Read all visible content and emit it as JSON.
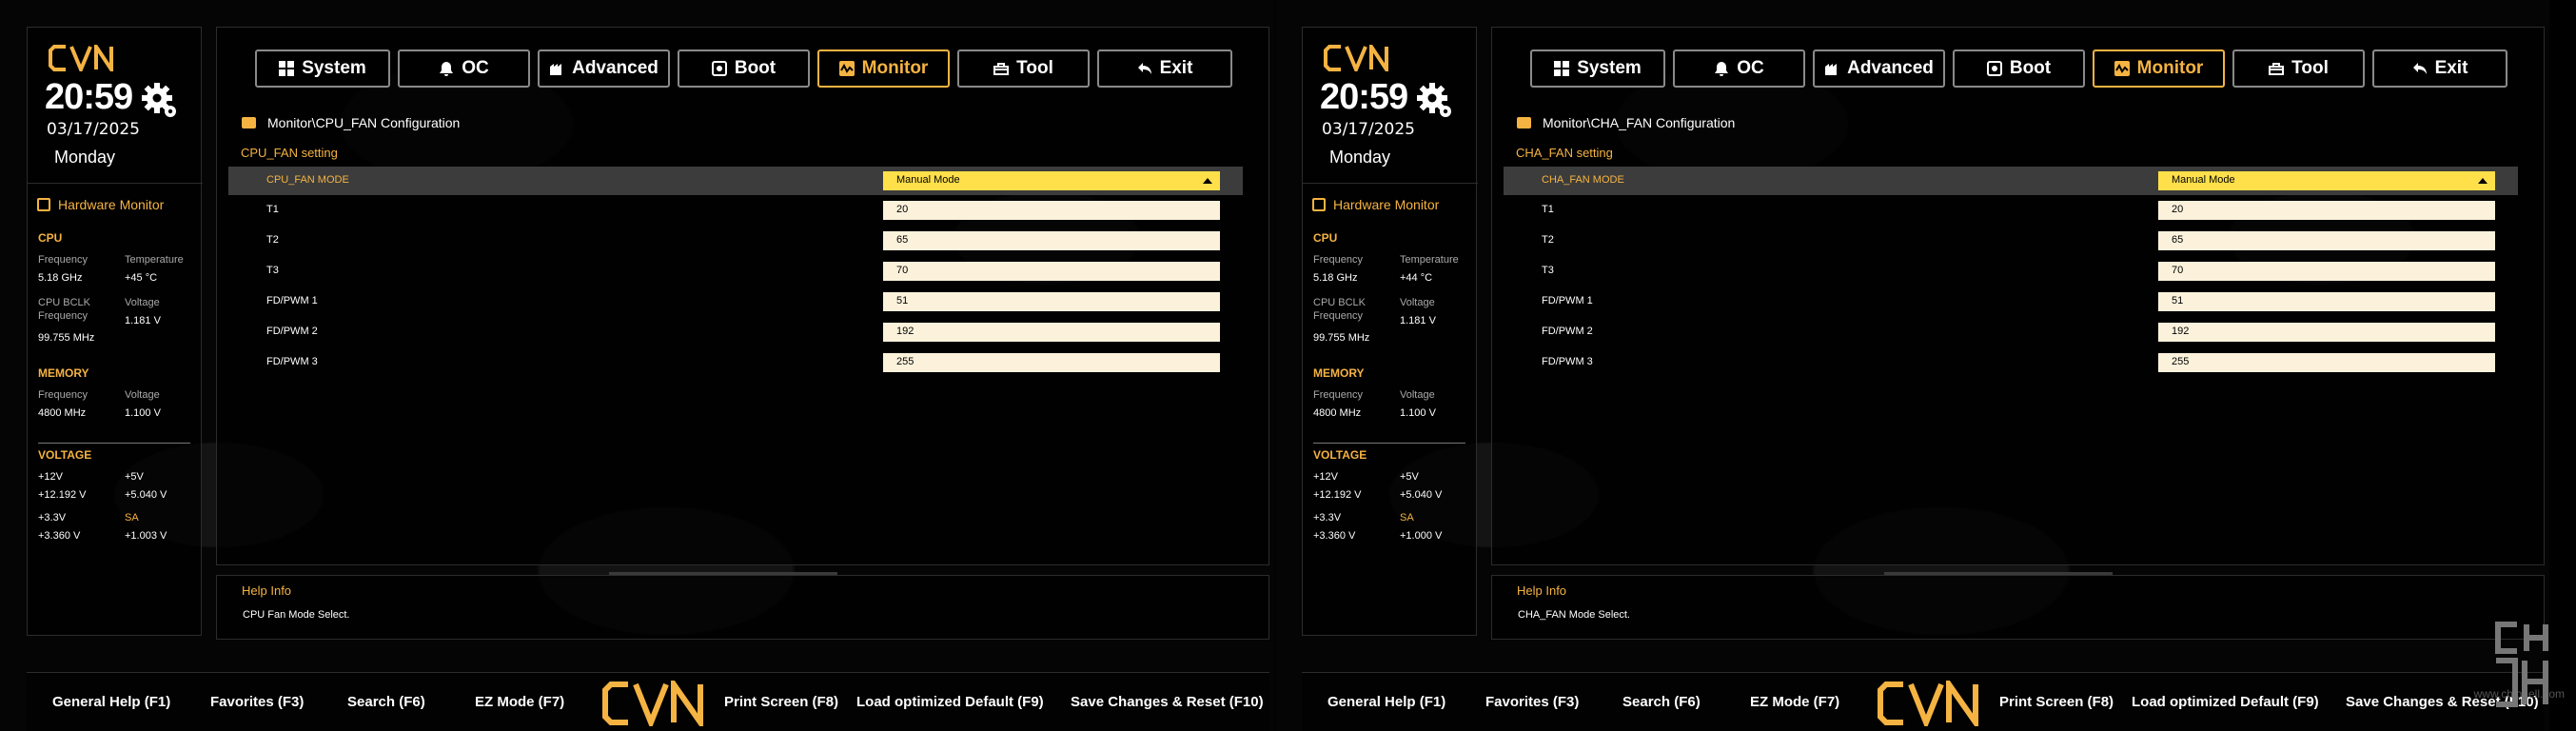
{
  "brand": {
    "accent": "#f5b342",
    "field_bg": "#fcf2dc",
    "dropdown_bg": "#ffe04a",
    "logo_text": "CVN"
  },
  "tabs": [
    {
      "label": "System",
      "icon": "grid-icon"
    },
    {
      "label": "OC",
      "icon": "bell-icon"
    },
    {
      "label": "Advanced",
      "icon": "chip-icon"
    },
    {
      "label": "Boot",
      "icon": "power-icon"
    },
    {
      "label": "Monitor",
      "icon": "monitor-wave-icon",
      "active": true
    },
    {
      "label": "Tool",
      "icon": "toolbox-icon"
    },
    {
      "label": "Exit",
      "icon": "back-arrow-icon"
    }
  ],
  "footer": {
    "general_help": "General Help (F1)",
    "favorites": "Favorites (F3)",
    "search": "Search (F6)",
    "ez_mode": "EZ Mode (F7)",
    "print_screen": "Print Screen (F8)",
    "load_default": "Load optimized Default (F9)",
    "save_reset": "Save Changes & Reset (F10)"
  },
  "watermark": "www.chiphell.com",
  "screens": [
    {
      "clock": {
        "time": "20:59",
        "date": "03/17/2025",
        "day": "Monday"
      },
      "hw": {
        "title": "Hardware Monitor",
        "cpu": {
          "title": "CPU",
          "freq_label": "Frequency",
          "freq": "5.18 GHz",
          "temp_label": "Temperature",
          "temp": "+45 °C",
          "bclk_label1": "CPU BCLK",
          "bclk_label2": "Frequency",
          "bclk": "99.755 MHz",
          "volt_label": "Voltage",
          "volt": "1.181 V"
        },
        "memory": {
          "title": "MEMORY",
          "freq_label": "Frequency",
          "freq": "4800 MHz",
          "volt_label": "Voltage",
          "volt": "1.100 V"
        },
        "voltage": {
          "title": "VOLTAGE",
          "v12_label": "+12V",
          "v12": "+12.192 V",
          "v5_label": "+5V",
          "v5": "+5.040 V",
          "v33_label": "+3.3V",
          "v33": "+3.360 V",
          "sa_label": "SA",
          "sa": "+1.003 V"
        }
      },
      "path": "Monitor\\CPU_FAN Configuration",
      "section": "CPU_FAN setting",
      "rows": [
        {
          "label": "CPU_FAN MODE",
          "value": "Manual Mode"
        },
        {
          "label": "T1",
          "value": "20"
        },
        {
          "label": "T2",
          "value": "65"
        },
        {
          "label": "T3",
          "value": "70"
        },
        {
          "label": "FD/PWM 1",
          "value": "51"
        },
        {
          "label": "FD/PWM 2",
          "value": "192"
        },
        {
          "label": "FD/PWM 3",
          "value": "255"
        }
      ],
      "help": {
        "title": "Help Info",
        "text": "CPU Fan Mode Select."
      }
    },
    {
      "clock": {
        "time": "20:59",
        "date": "03/17/2025",
        "day": "Monday"
      },
      "hw": {
        "title": "Hardware Monitor",
        "cpu": {
          "title": "CPU",
          "freq_label": "Frequency",
          "freq": "5.18 GHz",
          "temp_label": "Temperature",
          "temp": "+44 °C",
          "bclk_label1": "CPU BCLK",
          "bclk_label2": "Frequency",
          "bclk": "99.755 MHz",
          "volt_label": "Voltage",
          "volt": "1.181 V"
        },
        "memory": {
          "title": "MEMORY",
          "freq_label": "Frequency",
          "freq": "4800 MHz",
          "volt_label": "Voltage",
          "volt": "1.100 V"
        },
        "voltage": {
          "title": "VOLTAGE",
          "v12_label": "+12V",
          "v12": "+12.192 V",
          "v5_label": "+5V",
          "v5": "+5.040 V",
          "v33_label": "+3.3V",
          "v33": "+3.360 V",
          "sa_label": "SA",
          "sa": "+1.000 V"
        }
      },
      "path": "Monitor\\CHA_FAN Configuration",
      "section": "CHA_FAN setting",
      "rows": [
        {
          "label": "CHA_FAN MODE",
          "value": "Manual Mode"
        },
        {
          "label": "T1",
          "value": "20"
        },
        {
          "label": "T2",
          "value": "65"
        },
        {
          "label": "T3",
          "value": "70"
        },
        {
          "label": "FD/PWM 1",
          "value": "51"
        },
        {
          "label": "FD/PWM 2",
          "value": "192"
        },
        {
          "label": "FD/PWM 3",
          "value": "255"
        }
      ],
      "help": {
        "title": "Help Info",
        "text": "CHA_FAN Mode Select."
      }
    }
  ]
}
